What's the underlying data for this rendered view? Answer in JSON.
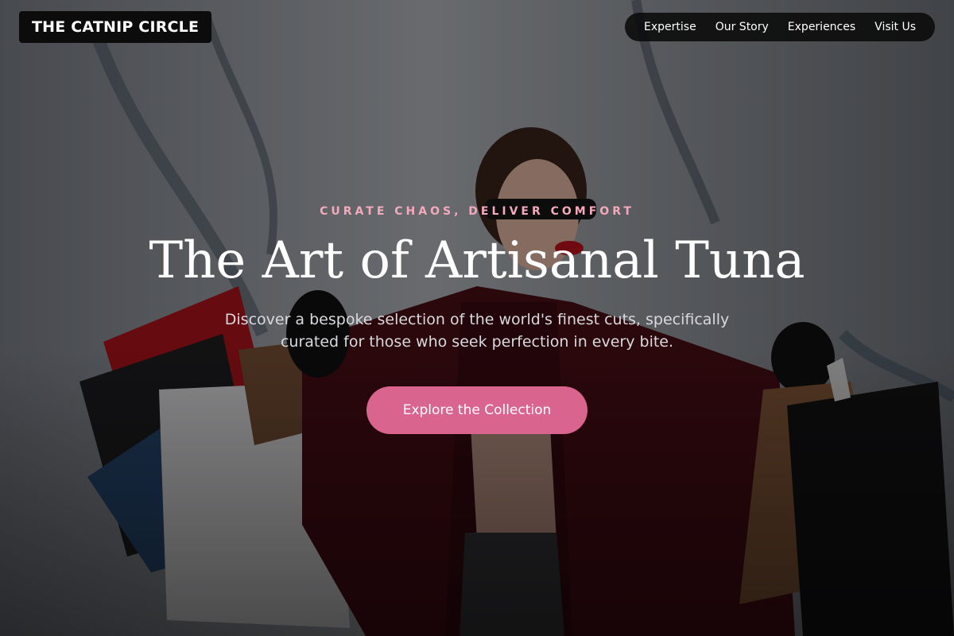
{
  "brand": {
    "logo_text": "THE CATNIP CIRCLE"
  },
  "nav": {
    "items": [
      {
        "label": "Expertise"
      },
      {
        "label": "Our Story"
      },
      {
        "label": "Experiences"
      },
      {
        "label": "Visit Us"
      }
    ]
  },
  "hero": {
    "eyebrow": "CURATE CHAOS, DELIVER COMFORT",
    "title": "The Art of Artisanal Tuna",
    "subtitle": "Discover a bespoke selection of the world's finest cuts, specifically curated for those who seek perfection in every bite.",
    "cta_label": "Explore the Collection",
    "background_image": "woman-with-shopping-bags-photo"
  },
  "colors": {
    "accent": "#d9658f",
    "eyebrow": "#f4a9bd",
    "logo_bg": "#0c0c0c",
    "nav_bg": "#0a0a0a"
  }
}
